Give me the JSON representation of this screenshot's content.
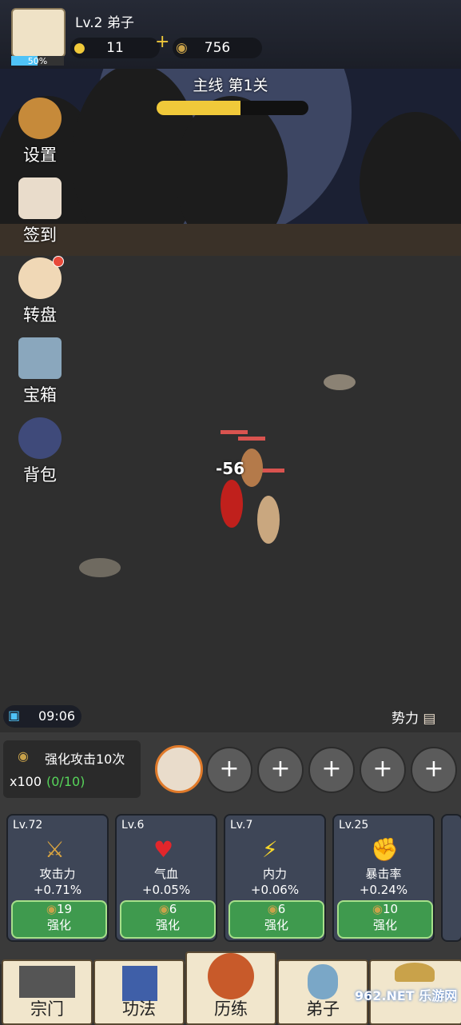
{
  "player": {
    "level": "Lv.2 弟子",
    "exp_percent": "50%",
    "exp_fraction": 0.5
  },
  "resources": {
    "gold": "11",
    "coins": "756"
  },
  "side_menu": [
    {
      "label": "设置"
    },
    {
      "label": "签到"
    },
    {
      "label": "转盘"
    },
    {
      "label": "宝箱"
    },
    {
      "label": "背包"
    }
  ],
  "stage": {
    "title": "主线 第1关",
    "progress": 0.55
  },
  "battle": {
    "damage": "-56"
  },
  "timer": "09:06",
  "faction_label": "势力",
  "task": {
    "title": "强化攻击10次",
    "reward": "x100",
    "progress": "(0/10)"
  },
  "upgrades": [
    {
      "level": "Lv.72",
      "icon": "sword-icon",
      "name": "攻击力",
      "value": "+0.71%",
      "cost": "19",
      "action": "强化"
    },
    {
      "level": "Lv.6",
      "icon": "heart-icon",
      "name": "气血",
      "value": "+0.05%",
      "cost": "6",
      "action": "强化"
    },
    {
      "level": "Lv.7",
      "icon": "lightning-icon",
      "name": "内力",
      "value": "+0.06%",
      "cost": "6",
      "action": "强化"
    },
    {
      "level": "Lv.25",
      "icon": "fist-icon",
      "name": "暴击率",
      "value": "+0.24%",
      "cost": "10",
      "action": "强化"
    }
  ],
  "nav": [
    {
      "label": "宗门"
    },
    {
      "label": "功法"
    },
    {
      "label": "历练"
    },
    {
      "label": "弟子"
    },
    {
      "label": "962.NET 乐游网"
    }
  ],
  "colors": {
    "accent_gold": "#f0c93a",
    "button_green": "#3f9a4e",
    "exp_blue": "#4fc3f7"
  }
}
